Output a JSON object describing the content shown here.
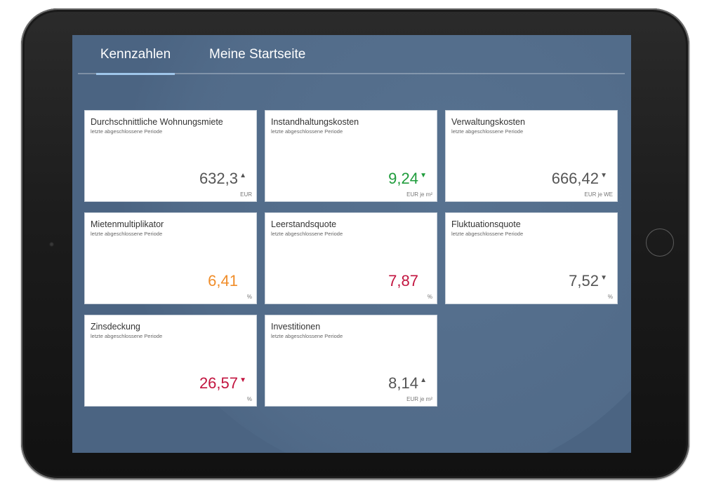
{
  "tabs": [
    {
      "label": "Kennzahlen",
      "active": true
    },
    {
      "label": "Meine Startseite",
      "active": false
    }
  ],
  "colors": {
    "screen_background": "#4b6482",
    "tab_indicator": "#9fc6ea",
    "value_default": "#555555",
    "value_orange": "#f08d2a",
    "value_green": "#1f9c3c",
    "value_red": "#c2143f"
  },
  "icons": {
    "trend_up": "▲",
    "trend_down": "▼"
  },
  "kpis": [
    {
      "title": "Durchschnittliche Wohnungsmiete",
      "subtitle": "letzte abgeschlossene Periode",
      "value": "632,3",
      "unit": "EUR",
      "trend": "up",
      "trend_symbol": "▲",
      "color": "default"
    },
    {
      "title": "Instandhaltungskosten",
      "subtitle": "letzte abgeschlossene Periode",
      "value": "9,24",
      "unit": "EUR je m²",
      "trend": "down",
      "trend_symbol": "▼",
      "color": "green"
    },
    {
      "title": "Verwaltungskosten",
      "subtitle": "letzte abgeschlossene Periode",
      "value": "666,42",
      "unit": "EUR je WE",
      "trend": "down",
      "trend_symbol": "▼",
      "color": "default"
    },
    {
      "title": "Mietenmultiplikator",
      "subtitle": "letzte abgeschlossene Periode",
      "value": "6,41",
      "unit": "%",
      "trend": "none",
      "trend_symbol": "",
      "color": "orange"
    },
    {
      "title": "Leerstandsquote",
      "subtitle": "letzte abgeschlossene Periode",
      "value": "7,87",
      "unit": "%",
      "trend": "none",
      "trend_symbol": "",
      "color": "red"
    },
    {
      "title": "Fluktuationsquote",
      "subtitle": "letzte abgeschlossene Periode",
      "value": "7,52",
      "unit": "%",
      "trend": "down",
      "trend_symbol": "▼",
      "color": "default"
    },
    {
      "title": "Zinsdeckung",
      "subtitle": "letzte abgeschlossene Periode",
      "value": "26,57",
      "unit": "%",
      "trend": "down",
      "trend_symbol": "▼",
      "color": "red"
    },
    {
      "title": "Investitionen",
      "subtitle": "letzte abgeschlossene Periode",
      "value": "8,14",
      "unit": "EUR je m²",
      "trend": "up",
      "trend_symbol": "▲",
      "color": "default"
    }
  ]
}
